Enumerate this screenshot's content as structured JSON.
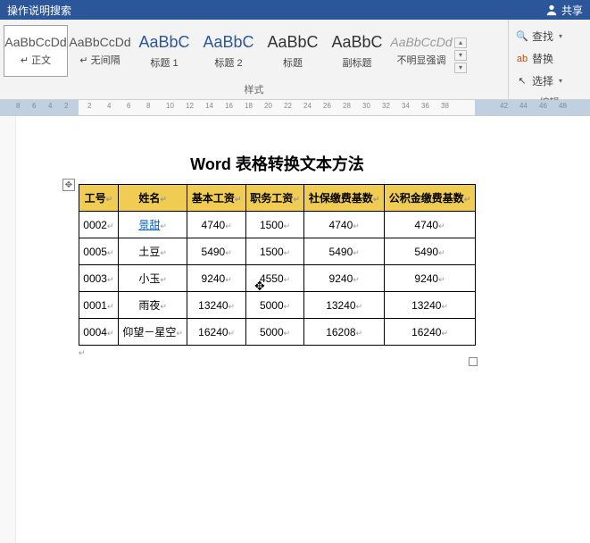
{
  "titlebar": {
    "search": "操作说明搜索",
    "share": "共享"
  },
  "styles": {
    "group_label": "样式",
    "items": [
      {
        "preview": "AaBbCcDd",
        "label": "正文",
        "cls": ""
      },
      {
        "preview": "AaBbCcDd",
        "label": "无间隔",
        "cls": ""
      },
      {
        "preview": "AaBbC",
        "label": "标题 1",
        "cls": "big"
      },
      {
        "preview": "AaBbC",
        "label": "标题 2",
        "cls": "big"
      },
      {
        "preview": "AaBbC",
        "label": "标题",
        "cls": "big2"
      },
      {
        "preview": "AaBbC",
        "label": "副标题",
        "cls": "big2"
      },
      {
        "preview": "AaBbCcDd",
        "label": "不明显强调",
        "cls": "italic"
      }
    ]
  },
  "edit": {
    "group_label": "编辑",
    "find": "查找",
    "replace": "替换",
    "select": "选择"
  },
  "ruler": {
    "left_ticks": [
      "8",
      "6",
      "4",
      "2"
    ],
    "right_ticks": [
      "2",
      "4",
      "6",
      "8",
      "10",
      "12",
      "14",
      "16",
      "18",
      "20",
      "22",
      "24",
      "26",
      "28",
      "30",
      "32",
      "34",
      "36",
      "38"
    ],
    "far_ticks": [
      "42",
      "44",
      "46",
      "48"
    ]
  },
  "document": {
    "title": "Word 表格转换文本方法",
    "headers": [
      "工号",
      "姓名",
      "基本工资",
      "职务工资",
      "社保缴费基数",
      "公积金缴费基数"
    ],
    "rows": [
      {
        "id": "0002",
        "name": "景甜",
        "link": true,
        "base": "4740",
        "duty": "1500",
        "sb": "4740",
        "gjj": "4740"
      },
      {
        "id": "0005",
        "name": "土豆",
        "link": false,
        "base": "5490",
        "duty": "1500",
        "sb": "5490",
        "gjj": "5490"
      },
      {
        "id": "0003",
        "name": "小玉",
        "link": false,
        "base": "9240",
        "duty": "4550",
        "sb": "9240",
        "gjj": "9240"
      },
      {
        "id": "0001",
        "name": "雨夜",
        "link": false,
        "base": "13240",
        "duty": "5000",
        "sb": "13240",
        "gjj": "13240"
      },
      {
        "id": "0004",
        "name": "仰望－星空",
        "link": false,
        "base": "16240",
        "duty": "5000",
        "sb": "16208",
        "gjj": "16240"
      }
    ]
  }
}
